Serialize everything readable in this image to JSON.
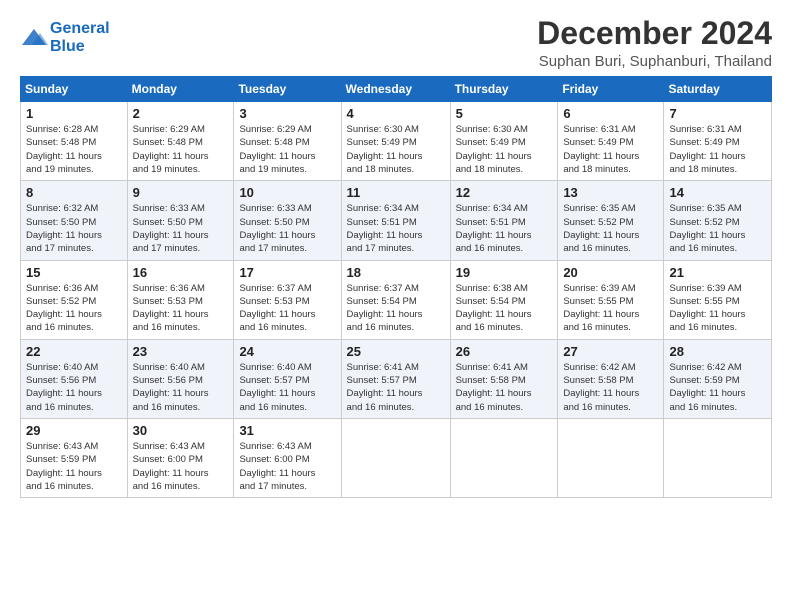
{
  "header": {
    "logo_line1": "General",
    "logo_line2": "Blue",
    "month_title": "December 2024",
    "location": "Suphan Buri, Suphanburi, Thailand"
  },
  "columns": [
    "Sunday",
    "Monday",
    "Tuesday",
    "Wednesday",
    "Thursday",
    "Friday",
    "Saturday"
  ],
  "weeks": [
    [
      {
        "day": "1",
        "info": "Sunrise: 6:28 AM\nSunset: 5:48 PM\nDaylight: 11 hours\nand 19 minutes."
      },
      {
        "day": "2",
        "info": "Sunrise: 6:29 AM\nSunset: 5:48 PM\nDaylight: 11 hours\nand 19 minutes."
      },
      {
        "day": "3",
        "info": "Sunrise: 6:29 AM\nSunset: 5:48 PM\nDaylight: 11 hours\nand 19 minutes."
      },
      {
        "day": "4",
        "info": "Sunrise: 6:30 AM\nSunset: 5:49 PM\nDaylight: 11 hours\nand 18 minutes."
      },
      {
        "day": "5",
        "info": "Sunrise: 6:30 AM\nSunset: 5:49 PM\nDaylight: 11 hours\nand 18 minutes."
      },
      {
        "day": "6",
        "info": "Sunrise: 6:31 AM\nSunset: 5:49 PM\nDaylight: 11 hours\nand 18 minutes."
      },
      {
        "day": "7",
        "info": "Sunrise: 6:31 AM\nSunset: 5:49 PM\nDaylight: 11 hours\nand 18 minutes."
      }
    ],
    [
      {
        "day": "8",
        "info": "Sunrise: 6:32 AM\nSunset: 5:50 PM\nDaylight: 11 hours\nand 17 minutes."
      },
      {
        "day": "9",
        "info": "Sunrise: 6:33 AM\nSunset: 5:50 PM\nDaylight: 11 hours\nand 17 minutes."
      },
      {
        "day": "10",
        "info": "Sunrise: 6:33 AM\nSunset: 5:50 PM\nDaylight: 11 hours\nand 17 minutes."
      },
      {
        "day": "11",
        "info": "Sunrise: 6:34 AM\nSunset: 5:51 PM\nDaylight: 11 hours\nand 17 minutes."
      },
      {
        "day": "12",
        "info": "Sunrise: 6:34 AM\nSunset: 5:51 PM\nDaylight: 11 hours\nand 16 minutes."
      },
      {
        "day": "13",
        "info": "Sunrise: 6:35 AM\nSunset: 5:52 PM\nDaylight: 11 hours\nand 16 minutes."
      },
      {
        "day": "14",
        "info": "Sunrise: 6:35 AM\nSunset: 5:52 PM\nDaylight: 11 hours\nand 16 minutes."
      }
    ],
    [
      {
        "day": "15",
        "info": "Sunrise: 6:36 AM\nSunset: 5:52 PM\nDaylight: 11 hours\nand 16 minutes."
      },
      {
        "day": "16",
        "info": "Sunrise: 6:36 AM\nSunset: 5:53 PM\nDaylight: 11 hours\nand 16 minutes."
      },
      {
        "day": "17",
        "info": "Sunrise: 6:37 AM\nSunset: 5:53 PM\nDaylight: 11 hours\nand 16 minutes."
      },
      {
        "day": "18",
        "info": "Sunrise: 6:37 AM\nSunset: 5:54 PM\nDaylight: 11 hours\nand 16 minutes."
      },
      {
        "day": "19",
        "info": "Sunrise: 6:38 AM\nSunset: 5:54 PM\nDaylight: 11 hours\nand 16 minutes."
      },
      {
        "day": "20",
        "info": "Sunrise: 6:39 AM\nSunset: 5:55 PM\nDaylight: 11 hours\nand 16 minutes."
      },
      {
        "day": "21",
        "info": "Sunrise: 6:39 AM\nSunset: 5:55 PM\nDaylight: 11 hours\nand 16 minutes."
      }
    ],
    [
      {
        "day": "22",
        "info": "Sunrise: 6:40 AM\nSunset: 5:56 PM\nDaylight: 11 hours\nand 16 minutes."
      },
      {
        "day": "23",
        "info": "Sunrise: 6:40 AM\nSunset: 5:56 PM\nDaylight: 11 hours\nand 16 minutes."
      },
      {
        "day": "24",
        "info": "Sunrise: 6:40 AM\nSunset: 5:57 PM\nDaylight: 11 hours\nand 16 minutes."
      },
      {
        "day": "25",
        "info": "Sunrise: 6:41 AM\nSunset: 5:57 PM\nDaylight: 11 hours\nand 16 minutes."
      },
      {
        "day": "26",
        "info": "Sunrise: 6:41 AM\nSunset: 5:58 PM\nDaylight: 11 hours\nand 16 minutes."
      },
      {
        "day": "27",
        "info": "Sunrise: 6:42 AM\nSunset: 5:58 PM\nDaylight: 11 hours\nand 16 minutes."
      },
      {
        "day": "28",
        "info": "Sunrise: 6:42 AM\nSunset: 5:59 PM\nDaylight: 11 hours\nand 16 minutes."
      }
    ],
    [
      {
        "day": "29",
        "info": "Sunrise: 6:43 AM\nSunset: 5:59 PM\nDaylight: 11 hours\nand 16 minutes."
      },
      {
        "day": "30",
        "info": "Sunrise: 6:43 AM\nSunset: 6:00 PM\nDaylight: 11 hours\nand 16 minutes."
      },
      {
        "day": "31",
        "info": "Sunrise: 6:43 AM\nSunset: 6:00 PM\nDaylight: 11 hours\nand 17 minutes."
      },
      {
        "day": "",
        "info": ""
      },
      {
        "day": "",
        "info": ""
      },
      {
        "day": "",
        "info": ""
      },
      {
        "day": "",
        "info": ""
      }
    ]
  ]
}
